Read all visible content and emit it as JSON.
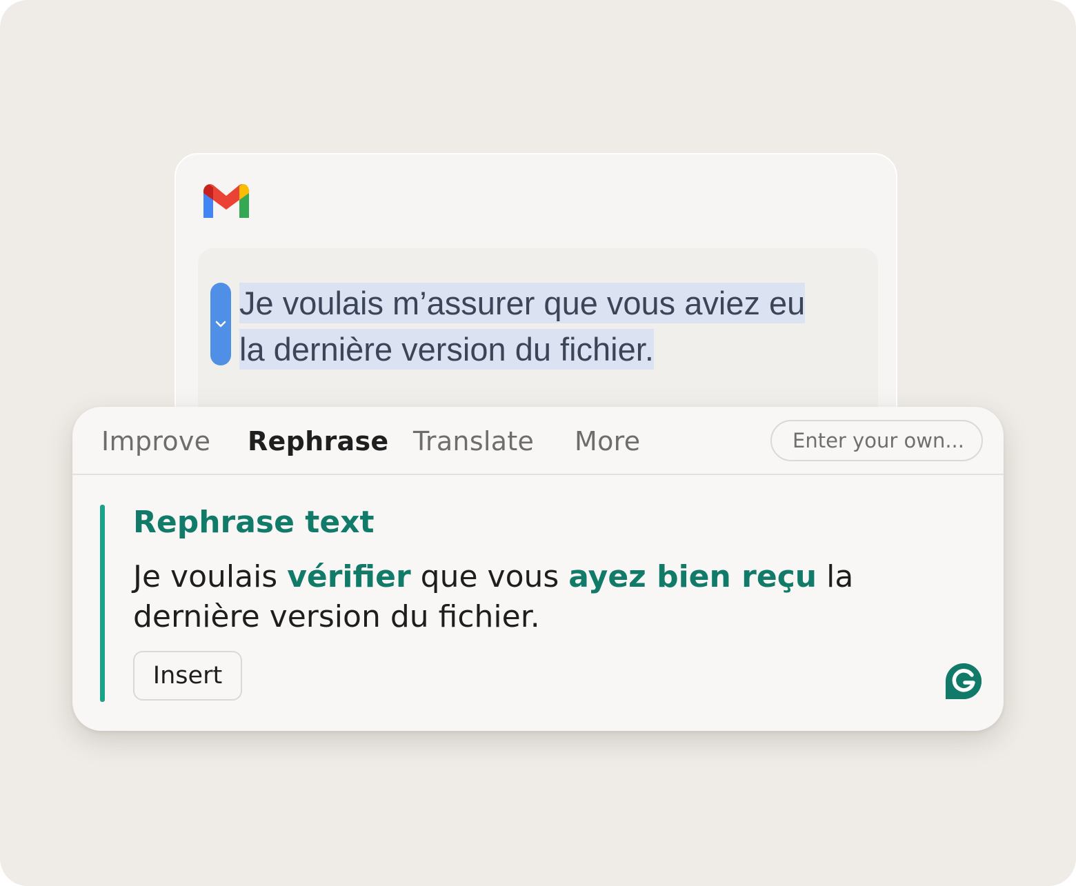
{
  "email": {
    "logo_icon": "gmail-logo-icon",
    "selection_handle_icon": "chevron-down-icon",
    "selected_line_1": "Je voulais m’assurer que vous aviez eu",
    "selected_line_2": "la dernière version du fichier."
  },
  "popup": {
    "tabs": [
      {
        "label": "Improve",
        "active": false
      },
      {
        "label": "Rephrase",
        "active": true
      },
      {
        "label": "Translate",
        "active": false
      },
      {
        "label": "More",
        "active": false
      }
    ],
    "prompt_input": {
      "value": "",
      "placeholder": "Enter your own..."
    },
    "result": {
      "title": "Rephrase text",
      "segments": [
        {
          "text": "Je voulais ",
          "changed": false
        },
        {
          "text": "vérifier",
          "changed": true
        },
        {
          "text": " que vous ",
          "changed": false
        },
        {
          "text": "ayez bien reçu",
          "changed": true
        },
        {
          "text": " la dernière version du fichier.",
          "changed": false
        }
      ]
    },
    "insert_label": "Insert",
    "brand_icon": "grammarly-logo-icon"
  },
  "colors": {
    "background": "#efece7",
    "accent_green": "#117a69",
    "accent_bar": "#1aa389",
    "selection_highlight": "#dbe3f3",
    "handle_blue": "#4f8fe6"
  }
}
